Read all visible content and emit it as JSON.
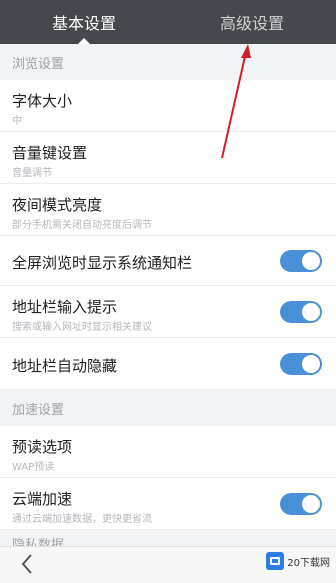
{
  "tabs": [
    {
      "label": "基本设置",
      "active": true
    },
    {
      "label": "高级设置",
      "active": false
    }
  ],
  "sections": {
    "browse": "浏览设置",
    "speed": "加速设置",
    "partial": "隐私数据"
  },
  "rows": {
    "font_size": {
      "label": "字体大小",
      "sub": "中"
    },
    "volume_key": {
      "label": "音量键设置",
      "sub": "音量调节"
    },
    "night_brightness": {
      "label": "夜间模式亮度",
      "sub": "部分手机需关闭自动亮度后调节"
    },
    "fullscreen_status": {
      "label": "全屏浏览时显示系统通知栏",
      "toggle": true
    },
    "address_hint": {
      "label": "地址栏输入提示",
      "sub": "搜索或输入网址时显示相关建议",
      "toggle": true
    },
    "address_autohide": {
      "label": "地址栏自动隐藏",
      "toggle": true
    },
    "preload": {
      "label": "预读选项",
      "sub": "WAP预读"
    },
    "cloud_accel": {
      "label": "云端加速",
      "sub": "通过云端加速数据，更快更省流",
      "toggle": true
    }
  },
  "bottom": {
    "back_icon": "chevron-left-icon"
  },
  "watermark": {
    "text": "20下载网"
  },
  "colors": {
    "header": "#45494d",
    "toggle_on": "#4a90d9",
    "annotation_arrow": "#d0202a"
  }
}
